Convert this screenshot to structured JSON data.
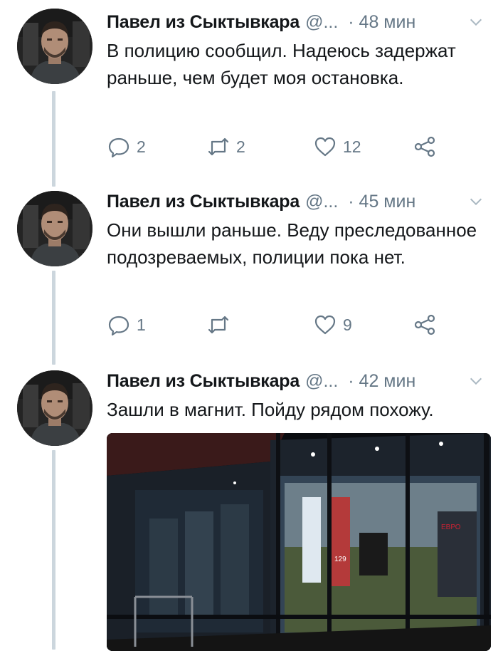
{
  "tweets": [
    {
      "author": "Павел из Сыктывкара",
      "handle": "@...",
      "time": "· 48 мин",
      "text": "В полицию сообщил. Надеюсь задержат раньше, чем будет моя остановка.",
      "replies": "2",
      "retweets": "2",
      "likes": "12"
    },
    {
      "author": "Павел из Сыктывкара",
      "handle": "@...",
      "time": "· 45 мин",
      "text": "Они вышли раньше. Веду преследованное подозреваемых, полиции пока нет.",
      "replies": "1",
      "retweets": "",
      "likes": "9"
    },
    {
      "author": "Павел из Сыктывкара",
      "handle": "@...",
      "time": "· 42 мин",
      "text": "Зашли в магнит. Пойду рядом похожу.",
      "media": {
        "sign_text": "ЕВРО",
        "price_text": "129"
      }
    }
  ],
  "icons": {
    "reply": "reply-icon",
    "retweet": "retweet-icon",
    "like": "heart-icon",
    "share": "share-icon",
    "caret": "chevron-down-icon"
  },
  "colors": {
    "text_primary": "#14171a",
    "text_secondary": "#657786",
    "thread_line": "#ccd6dd"
  }
}
